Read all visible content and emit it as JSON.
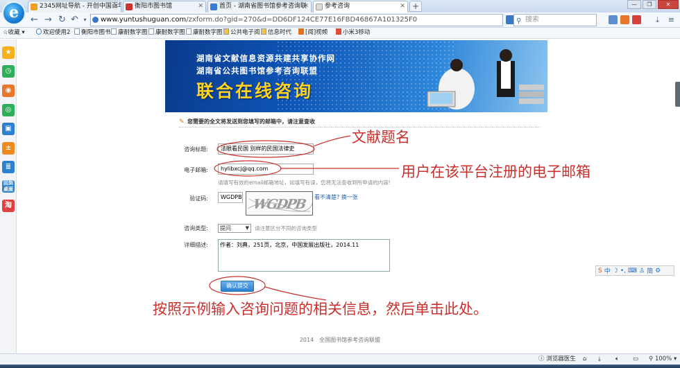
{
  "browser": {
    "tabs": [
      {
        "label": "2345网址导航 - 开创中国百年品",
        "active": false
      },
      {
        "label": "衡阳市图书馆",
        "active": false
      },
      {
        "label": "首页 - 湖南省图书馆参考咨询联",
        "active": false
      },
      {
        "label": "参考咨询",
        "active": true
      }
    ],
    "new_tab_label": "+",
    "url_host": "www.yuntushuguan.com",
    "url_path": "/zxform.do?gid=270&d=DD6DF124CE77E16FBD46867A101325F0",
    "search_placeholder": "搜索",
    "favorites_label": "收藏",
    "favorites": [
      "欢迎使用2",
      "衡阳市图书",
      "康耐数字图",
      "康耐数字图",
      "康耐数字图",
      "公共电子阅",
      "信息时代",
      "[阅]视频",
      "小米3移动"
    ]
  },
  "banner": {
    "line1": "湖南省文献信息资源共建共享协作网",
    "line2": "湖南省公共图书馆参考咨询联盟",
    "title": "联合在线咨询"
  },
  "form": {
    "notice": "您需要的全文将发送到您填写的邮箱中，请注意查收",
    "subject_label": "咨询标题:",
    "subject_value": "法眼看民国  别样的民国法律史",
    "email_label": "电子邮箱:",
    "email_value": "hylibxcj@qq.com",
    "email_hint": "请填写有效的email邮箱地址，如填写有误，您将无法查收到所申请的内容!",
    "captcha_label": "验证码:",
    "captcha_value": "WGDPB",
    "captcha_image_text": "WGDPB",
    "captcha_refresh": "看不清楚? 换一张",
    "category_label": "咨询类型:",
    "category_value": "提问",
    "category_hint": "请注意区分不同的咨询类型",
    "detail_label": "详细描述:",
    "detail_value": "作者：刘典，251页，北京，中国发展出版社，2014.11",
    "submit_label": "确认提交"
  },
  "footer": "2014　全国图书馆参考咨询联盟",
  "annotations": {
    "title_note": "文献题名",
    "email_note": "用户在该平台注册的电子邮箱",
    "submit_note": "按照示例输入咨询问题的相关信息，然后单击此处。"
  },
  "statusbar": {
    "accelerator": "浏览器医生",
    "zoom": "100%"
  },
  "colors": {
    "annotation_red": "#c8302e",
    "banner_title": "#ffd21f",
    "submit_blue": "#2e7fcf"
  }
}
